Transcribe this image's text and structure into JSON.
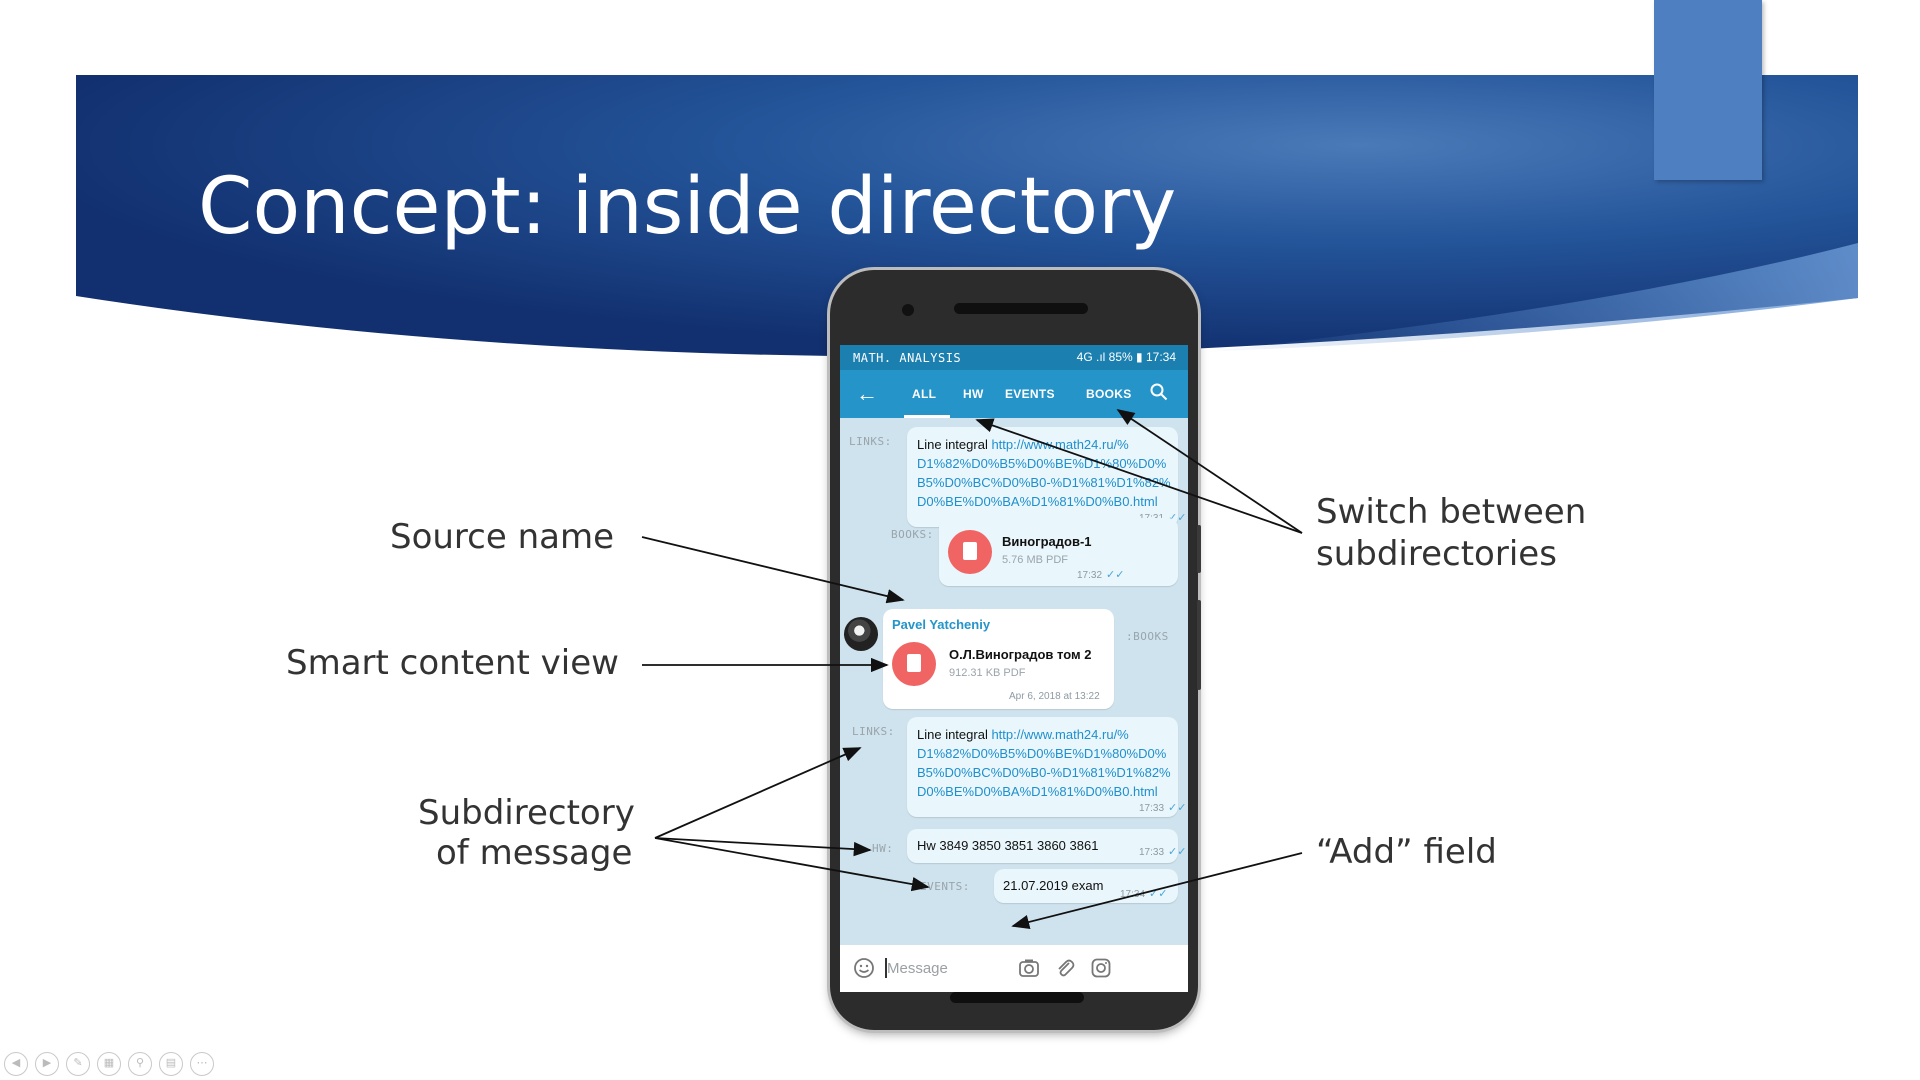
{
  "slide": {
    "title": "Concept: inside directory",
    "accent_color": "#4d7fc1",
    "banner_color": "#1b3f86"
  },
  "phone": {
    "status_bar": {
      "channel_name": "MATH. ANALYSIS",
      "system_text": "4G .ıl 85% ▮ 17:34"
    },
    "tabs": [
      {
        "label": "ALL",
        "active": true
      },
      {
        "label": "HW",
        "active": false
      },
      {
        "label": "EVENTS",
        "active": false
      },
      {
        "label": "BOOKS",
        "active": false
      }
    ],
    "messages": {
      "m1": {
        "subdir": "LINKS:",
        "text": "Line integral",
        "url": "http://www.math24.ru/%D1%82%D0%B5%D0%BE%D1%80%D0%B5%D0%BC%D0%B0-%D1%81%D1%82%D0%BE%D0%BA%D1%81%D0%B0.html",
        "url_lines": [
          "http://www.math24.ru/%",
          "D1%82%D0%B5%D0%BE%D1%80%D0%",
          "B5%D0%BC%D0%B0-%D1%81%D1%82%",
          "D0%BE%D0%BA%D1%81%D0%B0.html"
        ],
        "time": "17:31"
      },
      "m2": {
        "subdir": "BOOKS:",
        "file_name": "Виноградов-1",
        "file_meta": "5.76 MB PDF",
        "time": "17:32"
      },
      "m3": {
        "subdir": ":BOOKS",
        "sender": "Pavel Yatcheniy",
        "file_name": "О.Л.Виноградов том 2",
        "file_meta": "912.31 KB PDF",
        "time": "Apr 6, 2018 at 13:22"
      },
      "m4": {
        "subdir": "LINKS:",
        "text": "Line integral",
        "url_lines": [
          "http://www.math24.ru/%",
          "D1%82%D0%B5%D0%BE%D1%80%D0%",
          "B5%D0%BC%D0%B0-%D1%81%D1%82%",
          "D0%BE%D0%BA%D1%81%D0%B0.html"
        ],
        "time": "17:33"
      },
      "m5": {
        "subdir": "HW:",
        "text": "Hw 3849 3850 3851 3860 3861",
        "time": "17:33"
      },
      "m6": {
        "subdir": "EVENTS:",
        "text": "21.07.2019 exam",
        "time": "17:34"
      }
    },
    "input": {
      "placeholder": "Message"
    }
  },
  "annotations": {
    "source_name": "Source name",
    "smart_content": "Smart content view",
    "subdirectory_line1": "Subdirectory",
    "subdirectory_line2": "of message",
    "switch_line1": "Switch between",
    "switch_line2": "subdirectories",
    "add_field": "“Add” field"
  },
  "icons": [
    "back-arrow-icon",
    "search-icon",
    "pdf-file-icon",
    "sticker-icon",
    "camera-icon",
    "attach-icon",
    "instagram-icon",
    "double-check-icon"
  ]
}
